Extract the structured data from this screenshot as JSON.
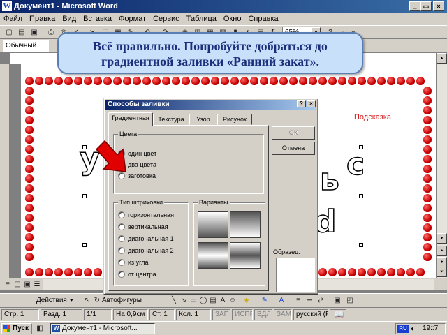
{
  "window": {
    "title": "Документ1 - Microsoft Word"
  },
  "menu": [
    "Файл",
    "Правка",
    "Вид",
    "Вставка",
    "Формат",
    "Сервис",
    "Таблица",
    "Окно",
    "Справка"
  ],
  "toolbar": {
    "zoom": "65%",
    "style": "Обычный"
  },
  "callout": {
    "text": "Всё правильно. Попробуйте добраться до градиентной заливки «Ранний закат»."
  },
  "document": {
    "hint": "Подсказка",
    "letters": [
      "у",
      "ь",
      "с",
      "d"
    ]
  },
  "dialog": {
    "title": "Способы заливки",
    "help_btn": "?",
    "close_btn": "×",
    "tabs": [
      "Градиентная",
      "Текстура",
      "Узор",
      "Рисунок"
    ],
    "colors_group": "Цвета",
    "color_options": [
      "один цвет",
      "два цвета",
      "заготовка"
    ],
    "hatch_group": "Тип штриховки",
    "hatch_options": [
      "горизонтальная",
      "вертикальная",
      "диагональная 1",
      "диагональная 2",
      "из угла",
      "от центра"
    ],
    "variants_group": "Варианты",
    "ok": "ОК",
    "cancel": "Отмена",
    "sample": "Образец:"
  },
  "drawbar": {
    "actions": "Действия",
    "autoshapes": "Автофигуры"
  },
  "status": {
    "page": "Стр. 1",
    "section": "Разд. 1",
    "pages": "1/1",
    "at": "На 0,9см",
    "line": "Ст. 1",
    "col": "Кол. 1",
    "rec": "ЗАП",
    "trk": "ИСПР",
    "ext": "ВДЛ",
    "ovr": "ЗАМ",
    "lang": "русский (Ро"
  },
  "taskbar": {
    "start": "Пуск",
    "task": "Документ1 - Microsoft...",
    "lang": "RU",
    "time": "19::7"
  }
}
